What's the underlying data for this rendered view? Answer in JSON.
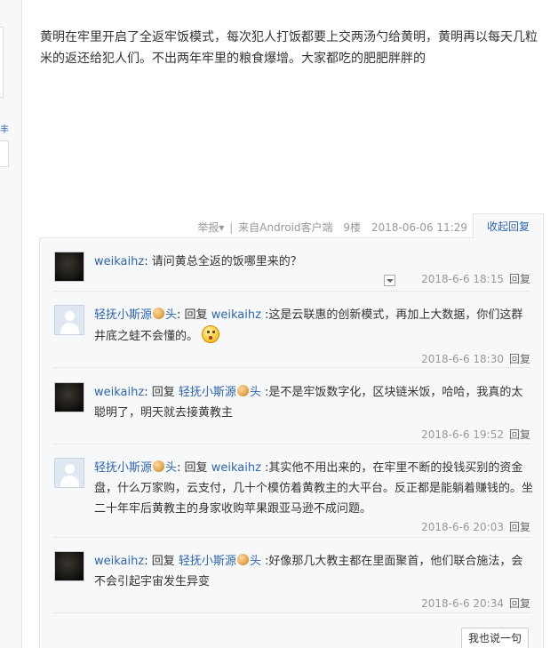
{
  "post": {
    "content": "黄明在牢里开启了全返牢饭模式，每次犯人打饭都要上交两汤勺给黄明，黄明再以每天几粒米的返还给犯人们。不出两年牢里的粮食爆增。大家都吃的肥肥胖胖的",
    "tail": {
      "report": "举报",
      "report_arrow": "▾",
      "separator": "|",
      "source_prefix": "来自",
      "source": "Android客户端",
      "floor": "9楼",
      "date": "2018-06-06 11:29"
    },
    "collapse_label": "收起回复"
  },
  "left_sidebar": {
    "mark": "丰"
  },
  "replies": [
    {
      "author": "weikaihz",
      "reply_word": "",
      "target": "",
      "target_suffix": "",
      "text": ": 请问黄总全返的饭哪里来的？",
      "time": "2018-6-6 18:15",
      "reply_label": "回复",
      "avatar": "dark"
    },
    {
      "author": "轻抚小斯源",
      "author_suffix": "头",
      "reply_word": "回复",
      "target": "weikaihz",
      "text": " :这是云联惠的创新模式，再加上大数据，你们这群井底之蛙不会懂的。",
      "time": "2018-6-6 18:30",
      "reply_label": "回复",
      "avatar": "default"
    },
    {
      "author": "weikaihz",
      "reply_word": "回复",
      "target": "轻抚小斯源",
      "target_suffix": "头",
      "text": " :是不是牢饭数字化，区块链米饭，哈哈，我真的太聪明了，明天就去接黄教主",
      "time": "2018-6-6 19:52",
      "reply_label": "回复",
      "avatar": "dark"
    },
    {
      "author": "轻抚小斯源",
      "author_suffix": "头",
      "reply_word": "回复",
      "target": "weikaihz",
      "text": " :其实他不用出来的，在牢里不断的投钱买别的资金盘，什么万家购，云支付，几十个模仿着黄教主的大平台。反正都是能躺着赚钱的。坐二十年牢后黄教主的身家收购苹果跟亚马逊不成问题。",
      "time": "2018-6-6 20:03",
      "reply_label": "回复",
      "avatar": "default"
    },
    {
      "author": "weikaihz",
      "reply_word": "回复",
      "target": "轻抚小斯源",
      "target_suffix": "头",
      "text": " :好像那几大教主都在里面聚首，他们联合施法，会不会引起宇宙发生异变",
      "time": "2018-6-6 20:34",
      "reply_label": "回复",
      "avatar": "dark"
    }
  ],
  "say_button": "我也说一句",
  "colors": {
    "link": "#2d64b3",
    "panel_bg": "#f7f8fa",
    "meta": "#999999"
  }
}
